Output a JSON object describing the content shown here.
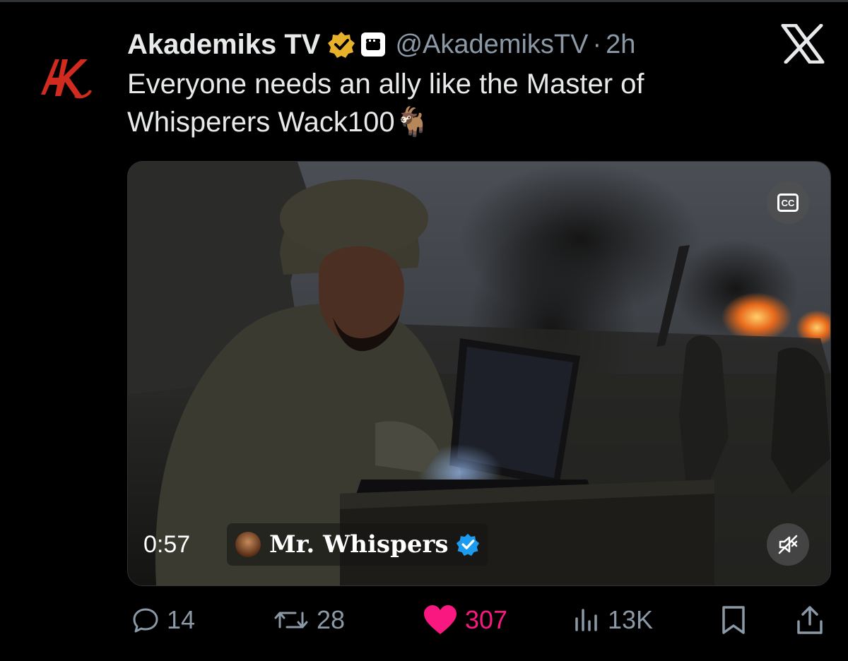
{
  "post": {
    "author_name": "Akademiks TV",
    "handle": "@AkademiksTV",
    "separator": "·",
    "time": "2h",
    "text": "Everyone needs an ally like the Master of Whisperers Wack100",
    "emoji": "🐐"
  },
  "avatar": {
    "logo_text": "AK",
    "logo_color": "#d12a1f"
  },
  "media": {
    "duration": "0:57",
    "attribution_name": "Mr. Whispers",
    "cc_label": "CC"
  },
  "actions": {
    "replies": "14",
    "reposts": "28",
    "likes": "307",
    "views": "13K"
  },
  "colors": {
    "background": "#000000",
    "text": "#e7e9ea",
    "muted": "#8b98a5",
    "like": "#f91880",
    "verified_gold": "#e8b12a",
    "verified_blue": "#1d9bf0"
  },
  "icons": [
    "x-logo-icon",
    "verified-gold-icon",
    "affiliate-badge-icon",
    "cc-icon",
    "mute-icon",
    "verified-blue-icon",
    "reply-icon",
    "repost-icon",
    "like-icon",
    "views-icon",
    "bookmark-icon",
    "share-icon"
  ]
}
